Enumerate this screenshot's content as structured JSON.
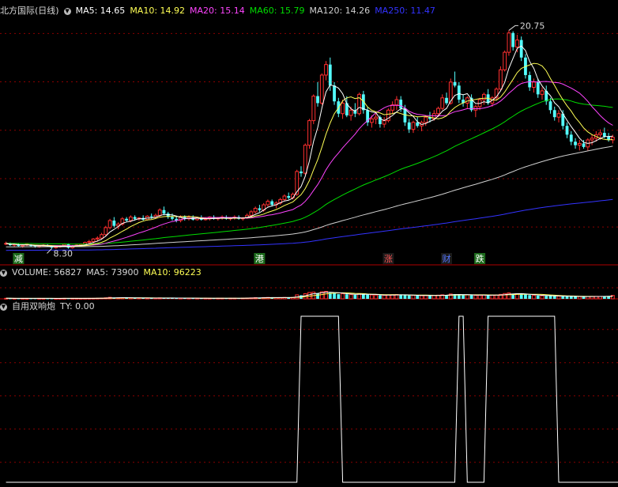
{
  "colors": {
    "bg": "#000000",
    "up": "#ff3030",
    "down": "#54ffff",
    "grid": "#8b0000",
    "text": "#d8d8d8",
    "ma5": "#ffffff",
    "ma10": "#ffff55",
    "ma20": "#ff44ff",
    "ma60": "#00dd00",
    "ma120": "#d0d0d0",
    "ma250": "#3333ff",
    "signal": "#ffffff"
  },
  "price_header": {
    "title": "北方国际(日线)",
    "icon": "chevron-down-icon",
    "ma5": "MA5: 14.65",
    "ma10": "MA10: 14.92",
    "ma20": "MA20: 15.14",
    "ma60": "MA60: 15.79",
    "ma120": "MA120: 14.26",
    "ma250": "MA250: 11.47"
  },
  "volume_header": {
    "title": "VOLUME: 56827",
    "ma5": "MA5: 73900",
    "ma10": "MA10: 96223"
  },
  "indicator_header": {
    "title": "自用双响炮",
    "ty": "TY: 0.00"
  },
  "annotations": {
    "high_label": "20.75",
    "low_label": "8.30",
    "events": [
      "减",
      "港",
      "涨",
      "财",
      "跌"
    ]
  },
  "chart_data": [
    {
      "type": "candlestick",
      "name": "price",
      "ylim": [
        7.6,
        21.4
      ],
      "high": 20.75,
      "low": 8.3,
      "ohlc": [
        [
          8.6,
          8.7,
          8.5,
          8.6
        ],
        [
          8.6,
          8.65,
          8.45,
          8.5
        ],
        [
          8.5,
          8.6,
          8.4,
          8.55
        ],
        [
          8.55,
          8.6,
          8.4,
          8.45
        ],
        [
          8.45,
          8.55,
          8.35,
          8.5
        ],
        [
          8.5,
          8.6,
          8.45,
          8.55
        ],
        [
          8.5,
          8.55,
          8.4,
          8.45
        ],
        [
          8.45,
          8.5,
          8.35,
          8.4
        ],
        [
          8.4,
          8.5,
          8.35,
          8.45
        ],
        [
          8.45,
          8.55,
          8.4,
          8.5
        ],
        [
          8.5,
          8.55,
          8.4,
          8.45
        ],
        [
          8.45,
          8.5,
          8.3,
          8.35
        ],
        [
          8.35,
          8.45,
          8.3,
          8.4
        ],
        [
          8.4,
          8.5,
          8.35,
          8.45
        ],
        [
          8.45,
          8.6,
          8.4,
          8.55
        ],
        [
          8.55,
          8.6,
          8.3,
          8.35
        ],
        [
          8.35,
          8.5,
          8.3,
          8.45
        ],
        [
          8.45,
          8.55,
          8.4,
          8.5
        ],
        [
          8.5,
          8.6,
          8.45,
          8.55
        ],
        [
          8.55,
          8.7,
          8.5,
          8.65
        ],
        [
          8.65,
          8.8,
          8.55,
          8.7
        ],
        [
          8.7,
          8.9,
          8.6,
          8.85
        ],
        [
          8.85,
          9.0,
          8.7,
          8.9
        ],
        [
          8.9,
          9.2,
          8.8,
          9.1
        ],
        [
          9.1,
          9.6,
          9.0,
          9.5
        ],
        [
          9.5,
          10.0,
          9.4,
          9.9
        ],
        [
          9.9,
          10.1,
          9.5,
          9.6
        ],
        [
          9.6,
          9.8,
          9.4,
          9.7
        ],
        [
          9.7,
          10.1,
          9.6,
          10.0
        ],
        [
          10.0,
          10.1,
          9.8,
          9.9
        ],
        [
          9.9,
          10.2,
          9.8,
          10.1
        ],
        [
          10.1,
          10.2,
          9.9,
          10.0
        ],
        [
          10.0,
          10.1,
          9.9,
          10.05
        ],
        [
          10.05,
          10.2,
          9.9,
          9.95
        ],
        [
          9.95,
          10.2,
          9.9,
          10.15
        ],
        [
          10.15,
          10.3,
          10.0,
          10.1
        ],
        [
          10.1,
          10.3,
          10.0,
          10.2
        ],
        [
          10.2,
          10.6,
          10.1,
          10.5
        ],
        [
          10.5,
          10.7,
          10.2,
          10.3
        ],
        [
          10.3,
          10.4,
          10.0,
          10.1
        ],
        [
          10.1,
          10.3,
          9.9,
          10.0
        ],
        [
          10.0,
          10.1,
          9.8,
          9.9
        ],
        [
          9.9,
          10.2,
          9.8,
          10.1
        ],
        [
          10.1,
          10.2,
          9.9,
          10.0
        ],
        [
          10.0,
          10.2,
          9.9,
          10.1
        ],
        [
          10.1,
          10.2,
          9.9,
          9.95
        ],
        [
          9.95,
          10.1,
          9.9,
          10.05
        ],
        [
          10.05,
          10.2,
          9.9,
          9.95
        ],
        [
          9.95,
          10.1,
          9.9,
          10.0
        ],
        [
          10.0,
          10.15,
          9.9,
          10.1
        ],
        [
          10.1,
          10.2,
          9.95,
          10.0
        ],
        [
          10.0,
          10.1,
          9.9,
          10.05
        ],
        [
          10.05,
          10.2,
          9.95,
          10.1
        ],
        [
          10.1,
          10.2,
          9.95,
          10.0
        ],
        [
          10.0,
          10.1,
          9.9,
          10.05
        ],
        [
          10.05,
          10.2,
          9.95,
          10.1
        ],
        [
          10.1,
          10.2,
          9.95,
          10.0
        ],
        [
          10.0,
          10.1,
          9.9,
          10.05
        ],
        [
          10.05,
          10.3,
          10.0,
          10.2
        ],
        [
          10.2,
          10.5,
          10.1,
          10.4
        ],
        [
          10.4,
          10.7,
          10.3,
          10.6
        ],
        [
          10.6,
          10.8,
          10.4,
          10.5
        ],
        [
          10.5,
          10.9,
          10.4,
          10.8
        ],
        [
          10.8,
          11.1,
          10.7,
          11.0
        ],
        [
          11.0,
          11.1,
          10.7,
          10.8
        ],
        [
          10.8,
          11.0,
          10.6,
          10.9
        ],
        [
          10.9,
          11.2,
          10.8,
          11.1
        ],
        [
          11.1,
          11.4,
          11.0,
          11.3
        ],
        [
          11.3,
          11.5,
          11.1,
          11.2
        ],
        [
          11.2,
          11.5,
          11.1,
          11.4
        ],
        [
          11.4,
          12.8,
          11.3,
          12.7
        ],
        [
          12.7,
          13.0,
          12.4,
          12.6
        ],
        [
          12.6,
          14.3,
          12.5,
          14.2
        ],
        [
          14.2,
          15.7,
          14.0,
          15.6
        ],
        [
          15.6,
          17.1,
          15.4,
          17.0
        ],
        [
          17.0,
          17.8,
          16.4,
          16.6
        ],
        [
          16.6,
          18.3,
          16.5,
          18.2
        ],
        [
          18.2,
          19.0,
          17.9,
          18.8
        ],
        [
          18.8,
          19.2,
          17.3,
          17.6
        ],
        [
          17.6,
          17.8,
          16.5,
          16.7
        ],
        [
          16.7,
          16.9,
          15.8,
          16.0
        ],
        [
          16.0,
          16.8,
          15.7,
          16.6
        ],
        [
          16.6,
          17.0,
          15.8,
          15.9
        ],
        [
          15.9,
          16.4,
          15.6,
          16.2
        ],
        [
          16.2,
          16.6,
          15.8,
          16.0
        ],
        [
          16.0,
          17.2,
          15.9,
          17.1
        ],
        [
          17.1,
          17.3,
          16.0,
          16.2
        ],
        [
          16.2,
          16.4,
          15.3,
          15.5
        ],
        [
          15.5,
          15.9,
          15.2,
          15.7
        ],
        [
          15.7,
          16.0,
          15.4,
          15.8
        ],
        [
          15.8,
          15.9,
          15.2,
          15.4
        ],
        [
          15.4,
          15.8,
          15.2,
          15.6
        ],
        [
          15.6,
          16.3,
          15.5,
          16.2
        ],
        [
          16.2,
          16.7,
          16.0,
          16.5
        ],
        [
          16.5,
          17.0,
          16.2,
          16.8
        ],
        [
          16.8,
          17.0,
          16.1,
          16.3
        ],
        [
          16.3,
          16.5,
          15.3,
          15.5
        ],
        [
          15.5,
          15.7,
          14.9,
          15.1
        ],
        [
          15.1,
          15.6,
          14.9,
          15.5
        ],
        [
          15.5,
          15.8,
          15.2,
          15.3
        ],
        [
          15.3,
          15.6,
          15.0,
          15.5
        ],
        [
          15.5,
          15.9,
          15.3,
          15.8
        ],
        [
          15.8,
          16.1,
          15.5,
          15.7
        ],
        [
          15.7,
          16.2,
          15.6,
          16.0
        ],
        [
          16.0,
          16.4,
          15.8,
          16.3
        ],
        [
          16.3,
          17.1,
          16.2,
          16.9
        ],
        [
          16.9,
          17.2,
          16.5,
          16.6
        ],
        [
          16.6,
          18.0,
          16.5,
          17.8
        ],
        [
          17.8,
          18.4,
          17.5,
          17.6
        ],
        [
          17.6,
          17.8,
          16.6,
          16.8
        ],
        [
          16.8,
          17.1,
          16.4,
          16.6
        ],
        [
          16.6,
          17.0,
          16.3,
          16.9
        ],
        [
          16.9,
          17.1,
          16.1,
          16.2
        ],
        [
          16.2,
          16.5,
          15.8,
          16.4
        ],
        [
          16.4,
          16.9,
          16.2,
          16.8
        ],
        [
          16.8,
          17.2,
          16.5,
          17.1
        ],
        [
          17.1,
          17.4,
          16.5,
          16.6
        ],
        [
          16.6,
          17.0,
          16.4,
          16.9
        ],
        [
          16.9,
          17.5,
          16.8,
          17.4
        ],
        [
          17.4,
          18.7,
          17.3,
          18.5
        ],
        [
          18.5,
          19.6,
          18.4,
          19.5
        ],
        [
          19.5,
          20.75,
          19.3,
          20.6
        ],
        [
          20.6,
          20.7,
          19.6,
          19.8
        ],
        [
          19.8,
          20.5,
          19.5,
          20.2
        ],
        [
          20.2,
          20.4,
          19.0,
          19.2
        ],
        [
          19.2,
          19.4,
          18.0,
          18.2
        ],
        [
          18.2,
          18.4,
          17.3,
          17.5
        ],
        [
          17.5,
          18.0,
          17.2,
          17.8
        ],
        [
          17.8,
          18.0,
          16.9,
          17.1
        ],
        [
          17.1,
          17.5,
          16.8,
          17.3
        ],
        [
          17.3,
          17.6,
          16.5,
          16.7
        ],
        [
          16.7,
          16.9,
          16.0,
          16.2
        ],
        [
          16.2,
          16.4,
          15.6,
          15.8
        ],
        [
          15.8,
          16.2,
          15.5,
          16.0
        ],
        [
          16.0,
          16.2,
          15.1,
          15.3
        ],
        [
          15.3,
          15.5,
          14.6,
          14.8
        ],
        [
          14.8,
          15.0,
          14.2,
          14.4
        ],
        [
          14.4,
          14.6,
          14.0,
          14.2
        ],
        [
          14.2,
          14.5,
          13.9,
          14.3
        ],
        [
          14.3,
          14.5,
          14.0,
          14.1
        ],
        [
          14.1,
          14.6,
          13.9,
          14.5
        ],
        [
          14.5,
          14.8,
          14.2,
          14.6
        ],
        [
          14.6,
          15.0,
          14.4,
          14.8
        ],
        [
          14.8,
          15.1,
          14.5,
          14.9
        ],
        [
          14.9,
          15.2,
          14.6,
          14.7
        ],
        [
          14.7,
          14.9,
          14.4,
          14.5
        ],
        [
          14.5,
          14.8,
          14.3,
          14.65
        ]
      ]
    },
    {
      "type": "bar",
      "name": "volume",
      "ylim": [
        0,
        340000
      ],
      "values": [
        9000,
        8500,
        8000,
        7600,
        7400,
        7200,
        7800,
        8100,
        7500,
        7300,
        7000,
        6900,
        7100,
        7400,
        7800,
        8600,
        7900,
        7600,
        7300,
        8000,
        8700,
        9300,
        10600,
        12800,
        17600,
        25400,
        21000,
        16600,
        18800,
        15900,
        17000,
        14500,
        13200,
        12700,
        12100,
        11600,
        12900,
        15400,
        14800,
        13600,
        12400,
        11300,
        11900,
        11400,
        11200,
        10900,
        10700,
        10400,
        10600,
        10200,
        10100,
        10500,
        11000,
        10300,
        10600,
        10800,
        11400,
        11900,
        13800,
        16200,
        20400,
        18900,
        21200,
        24000,
        20000,
        19300,
        20700,
        23300,
        21900,
        23400,
        66000,
        59000,
        85400,
        105000,
        112000,
        93000,
        117000,
        124000,
        101000,
        90000,
        77000,
        84000,
        76000,
        71000,
        68000,
        86000,
        80000,
        70000,
        65000,
        62000,
        58000,
        59000,
        64000,
        69000,
        72000,
        67000,
        61000,
        56000,
        58000,
        54000,
        53000,
        56000,
        54000,
        58000,
        61000,
        67000,
        64000,
        80000,
        78000,
        68000,
        63000,
        66000,
        60000,
        58000,
        61000,
        63000,
        60000,
        62000,
        64000,
        74000,
        88000,
        98000,
        82000,
        86000,
        77000,
        71000,
        62000,
        57000,
        54000,
        52000,
        50000,
        48000,
        46000,
        44000,
        42000,
        40000,
        39000,
        38000,
        37000,
        38000,
        39000,
        40000,
        41000,
        40000,
        42000,
        43000,
        56827
      ],
      "ma5_last": 73900,
      "ma10_last": 96223
    },
    {
      "type": "line",
      "name": "自用双响炮",
      "ylim": [
        0,
        1
      ],
      "values": [
        0,
        0,
        0,
        0,
        0,
        0,
        0,
        0,
        0,
        0,
        0,
        0,
        0,
        0,
        0,
        0,
        0,
        0,
        0,
        0,
        0,
        0,
        0,
        0,
        0,
        0,
        0,
        0,
        0,
        0,
        0,
        0,
        0,
        0,
        0,
        0,
        0,
        0,
        0,
        0,
        0,
        0,
        0,
        0,
        0,
        0,
        0,
        0,
        0,
        0,
        0,
        0,
        0,
        0,
        0,
        0,
        0,
        0,
        0,
        0,
        0,
        0,
        0,
        0,
        0,
        0,
        0,
        0,
        0,
        0,
        0,
        1,
        1,
        1,
        1,
        1,
        1,
        1,
        1,
        1,
        1,
        0,
        0,
        0,
        0,
        0,
        0,
        0,
        0,
        0,
        0,
        0,
        0,
        0,
        0,
        0,
        0,
        0,
        0,
        0,
        0,
        0,
        0,
        0,
        0,
        0,
        0,
        0,
        0,
        1,
        1,
        0,
        0,
        0,
        0,
        0,
        1,
        1,
        1,
        1,
        1,
        1,
        1,
        1,
        1,
        1,
        1,
        1,
        1,
        1,
        1,
        1,
        1,
        0,
        0,
        0,
        0,
        0,
        0,
        0,
        0,
        0,
        0,
        0,
        0,
        0,
        0,
        0,
        0,
        0,
        0
      ]
    }
  ]
}
